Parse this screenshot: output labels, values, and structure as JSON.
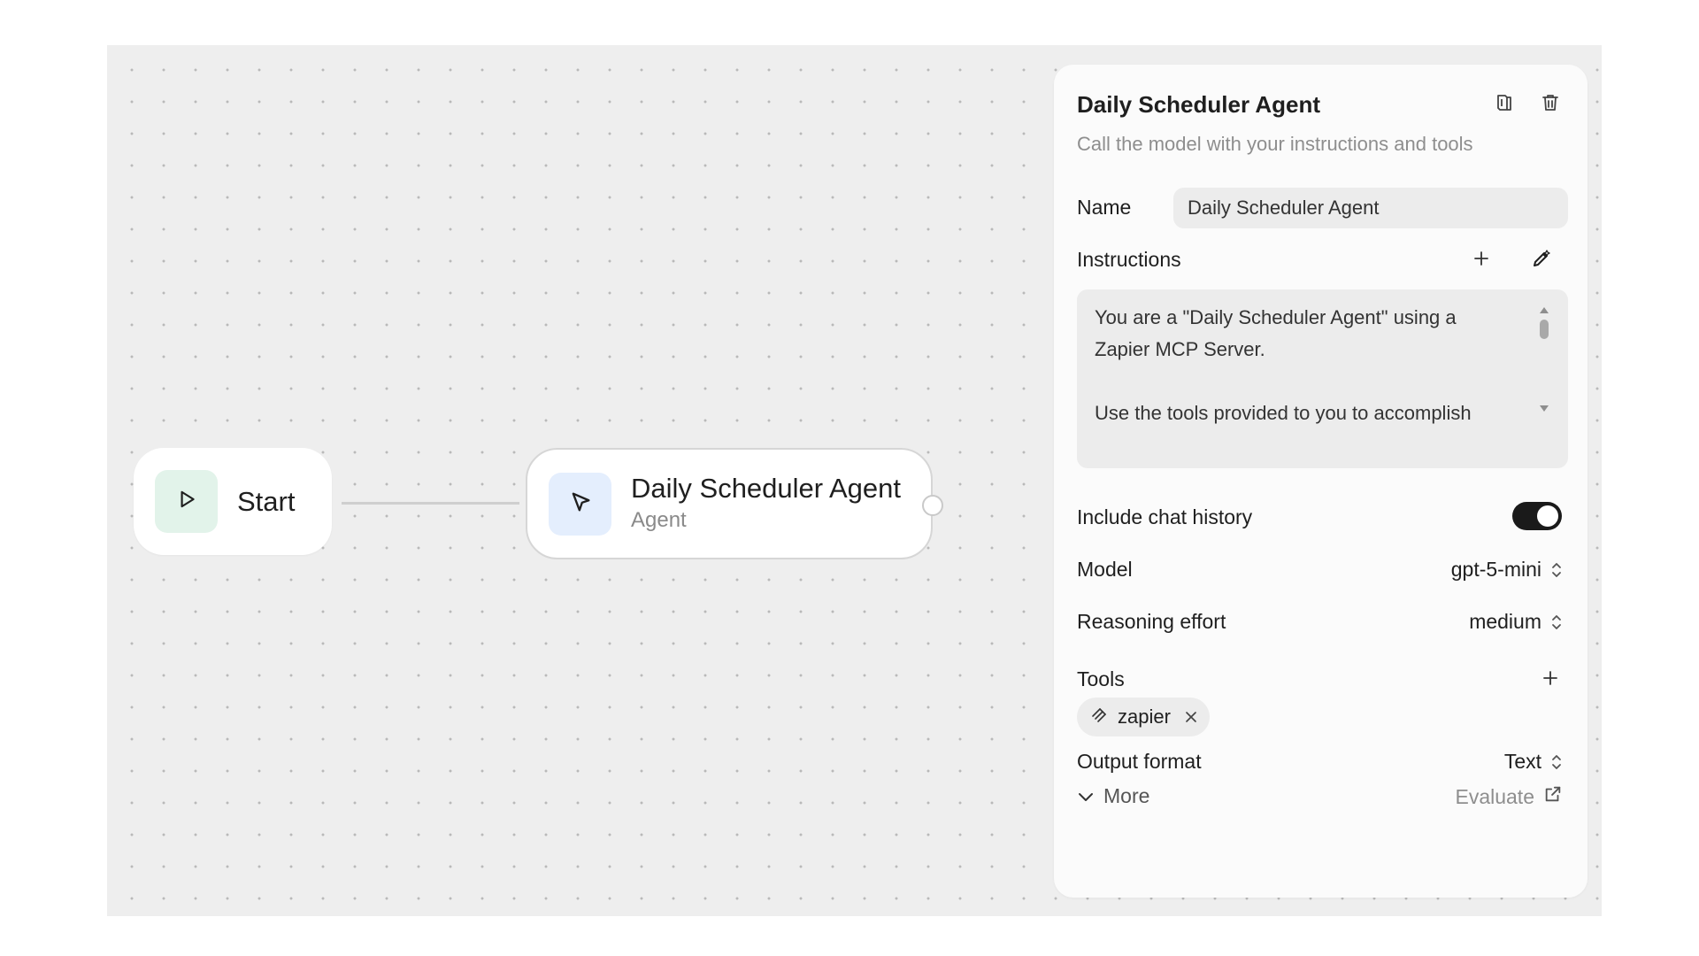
{
  "canvas": {
    "start_node": {
      "label": "Start",
      "icon": "play-icon"
    },
    "agent_node": {
      "title": "Daily Scheduler Agent",
      "subtitle": "Agent",
      "icon": "cursor-icon"
    }
  },
  "panel": {
    "title": "Daily Scheduler Agent",
    "description": "Call the model with your instructions and tools",
    "header_icons": [
      "copy-icon",
      "trash-icon"
    ],
    "name_label": "Name",
    "name_value": "Daily Scheduler Agent",
    "instructions_label": "Instructions",
    "instructions_lines": [
      "You are a \"Daily Scheduler Agent\" using a Zapier MCP Server.",
      "Use the tools provided to you to accomplish"
    ],
    "chat_history_label": "Include chat history",
    "chat_history_enabled": true,
    "model_label": "Model",
    "model_value": "gpt-5-mini",
    "reasoning_label": "Reasoning effort",
    "reasoning_value": "medium",
    "tools_label": "Tools",
    "tools": [
      {
        "name": "zapier",
        "icon": "zapier-icon"
      }
    ],
    "output_label": "Output format",
    "output_value": "Text",
    "more_label": "More",
    "evaluate_label": "Evaluate"
  },
  "colors": {
    "canvas_bg": "#eeeeee",
    "start_icon_bg": "#e2f3ea",
    "agent_icon_bg": "#e4eefd",
    "toggle_on": "#1a1a1a"
  }
}
